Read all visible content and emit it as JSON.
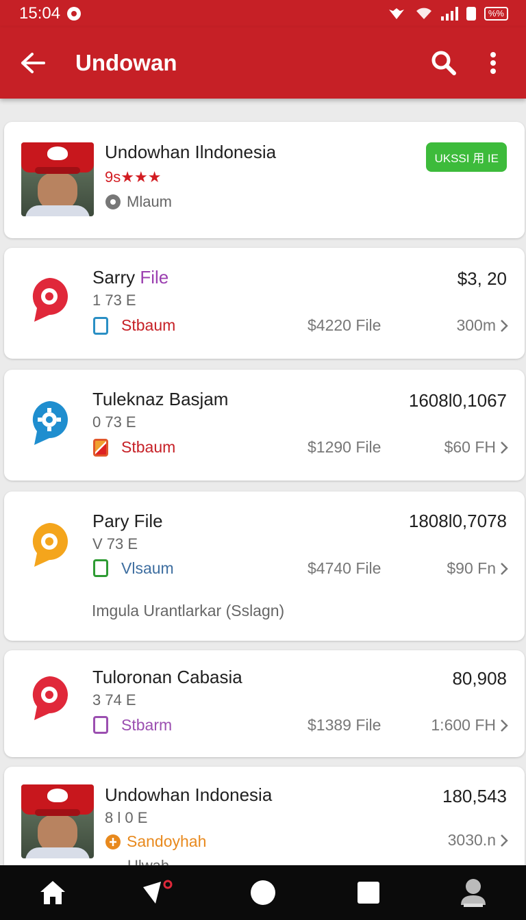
{
  "status_bar": {
    "time": "15:04",
    "battery_label": "%%"
  },
  "app_bar": {
    "title": "Undowan"
  },
  "header_card": {
    "name": "Undowhan Ilndonesia",
    "rating_prefix": "9s",
    "stars": "★★★",
    "location": "Mlaum",
    "badge": "UKSSI 用 IE",
    "colors": {
      "badge": "#3dbb3b",
      "stars": "#d21c22"
    }
  },
  "items": [
    {
      "title_a": "Sarry ",
      "title_b": "File",
      "code": "1 73 E",
      "tag": "Stbaum",
      "mid": "$4220 File",
      "value": "$3, 20",
      "meta": "300m",
      "pin_color": "#e0283a",
      "pin_icon": "ring",
      "tag_color": "#c62026",
      "tag_icon_color": "#2a8fc4"
    },
    {
      "title_a": "Tuleknaz Basjam",
      "title_b": "",
      "code": "0 73 E",
      "tag": "Stbaum",
      "mid": "$1290 File",
      "value": "1608l0,1067",
      "meta": "$60 FH",
      "pin_color": "#1f8ecf",
      "pin_icon": "gear",
      "tag_color": "#c62026",
      "tag_icon_color": "#e1572a"
    },
    {
      "title_a": "Pary File",
      "title_b": "",
      "code": "V 73 E",
      "tag": "Vlsaum",
      "mid": "$4740 File",
      "value": "1808l0,7078",
      "meta": "$90 Fn",
      "note": "Imgula Urantlarkar (Sslagn)",
      "pin_color": "#f4a51c",
      "pin_icon": "ring",
      "tag_color": "#3e6ea0",
      "tag_icon_color": "#2e9b33"
    },
    {
      "title_a": "Tuloronan Cabasia",
      "title_b": "",
      "code": "3 74 E",
      "tag": "Stbarm",
      "mid": "$1389 File",
      "value": "80,908",
      "meta": "1:600 FH",
      "pin_color": "#e0283a",
      "pin_icon": "ring",
      "tag_color": "#9b4fb0",
      "tag_icon_color": "#9b4fb0"
    }
  ],
  "last_card": {
    "name": "Undowhan Indonesia",
    "code": "8 l 0 E",
    "tag": "Sandoyhah",
    "value": "180,543",
    "meta": "3030.n",
    "partial": "Ulwah",
    "tag_color": "#e8891d"
  },
  "bottom_nav": {
    "items": [
      "home-icon",
      "notifications-icon",
      "record-icon",
      "stop-icon",
      "profile-icon"
    ]
  }
}
